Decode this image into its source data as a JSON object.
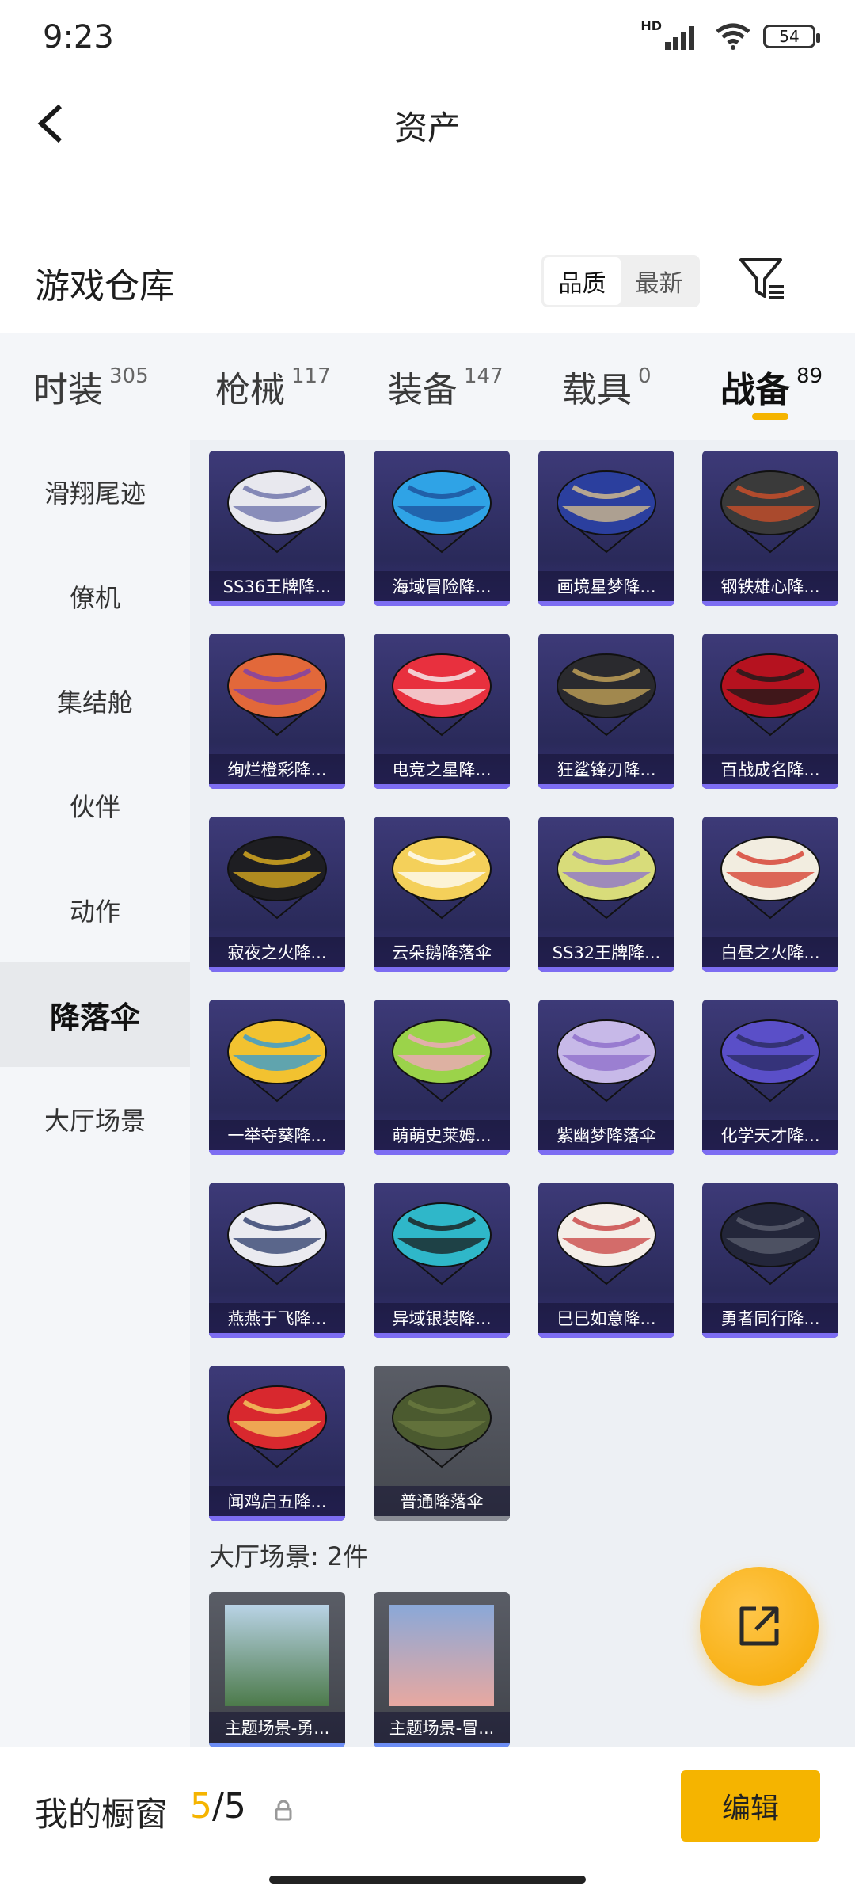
{
  "status_bar": {
    "time": "9:23",
    "hd": "HD",
    "battery": "54"
  },
  "header": {
    "title": "资产"
  },
  "warehouse": {
    "title": "游戏仓库",
    "sort_options": [
      "品质",
      "最新"
    ],
    "sort_active": "品质"
  },
  "tabs": [
    {
      "label": "时装",
      "count": "305"
    },
    {
      "label": "枪械",
      "count": "117"
    },
    {
      "label": "装备",
      "count": "147"
    },
    {
      "label": "载具",
      "count": "0"
    },
    {
      "label": "战备",
      "count": "89",
      "active": true
    }
  ],
  "side_nav": [
    "滑翔尾迹",
    "僚机",
    "集结舱",
    "伙伴",
    "动作",
    "降落伞",
    "大厅场景"
  ],
  "side_nav_active": "降落伞",
  "parachutes": [
    {
      "name": "SS36王牌降...",
      "colors": [
        "#e8e8ee",
        "#6a6fa8"
      ]
    },
    {
      "name": "海域冒险降...",
      "colors": [
        "#2fa3e6",
        "#1d4f9a"
      ]
    },
    {
      "name": "画境星梦降...",
      "colors": [
        "#2b3f9e",
        "#d9c18c"
      ]
    },
    {
      "name": "钢铁雄心降...",
      "colors": [
        "#3a3a3a",
        "#d0502a"
      ]
    },
    {
      "name": "绚烂橙彩降...",
      "colors": [
        "#e2683a",
        "#7a3fae"
      ]
    },
    {
      "name": "电竞之星降...",
      "colors": [
        "#e8303e",
        "#f5f5f5"
      ]
    },
    {
      "name": "狂鲨锋刃降...",
      "colors": [
        "#2a2a2e",
        "#c9a85a"
      ]
    },
    {
      "name": "百战成名降...",
      "colors": [
        "#b5121f",
        "#1a1a1a"
      ]
    },
    {
      "name": "寂夜之火降...",
      "colors": [
        "#1e1e22",
        "#e0b020"
      ]
    },
    {
      "name": "云朵鹅降落伞",
      "colors": [
        "#f4d05a",
        "#ffffff"
      ]
    },
    {
      "name": "SS32王牌降...",
      "colors": [
        "#d8dc7a",
        "#8b6fd0"
      ]
    },
    {
      "name": "白昼之火降...",
      "colors": [
        "#f2ede0",
        "#d4382a"
      ]
    },
    {
      "name": "一举夺葵降...",
      "colors": [
        "#f2c230",
        "#2f9ad8"
      ]
    },
    {
      "name": "萌萌史莱姆...",
      "colors": [
        "#9bd34a",
        "#f3a6c0"
      ]
    },
    {
      "name": "紫幽梦降落伞",
      "colors": [
        "#c7b9e8",
        "#8c6cc9"
      ]
    },
    {
      "name": "化学天才降...",
      "colors": [
        "#5a4fc8",
        "#2a2a60"
      ]
    },
    {
      "name": "燕燕于飞降...",
      "colors": [
        "#eaeaf0",
        "#2a3a6a"
      ]
    },
    {
      "name": "异域银装降...",
      "colors": [
        "#2fb7c9",
        "#1a1a1a"
      ]
    },
    {
      "name": "巳巳如意降...",
      "colors": [
        "#f4eee8",
        "#c84040"
      ]
    },
    {
      "name": "勇者同行降...",
      "colors": [
        "#23263a",
        "#5c6070"
      ]
    },
    {
      "name": "闻鸡启五降...",
      "colors": [
        "#d8282e",
        "#f5d060"
      ]
    },
    {
      "name": "普通降落伞",
      "colors": [
        "#4b5a2f",
        "#6a7a40"
      ],
      "gray": true
    }
  ],
  "scene_section": {
    "title": "大厅场景: 2件",
    "items": [
      {
        "name": "主题场景-勇...",
        "colors": [
          "#b9d3e6",
          "#4c7a4a"
        ]
      },
      {
        "name": "主题场景-冒...",
        "colors": [
          "#8aa8d8",
          "#e8a8a0"
        ]
      }
    ]
  },
  "bottom": {
    "showcase_label": "我的橱窗",
    "count_current": "5",
    "count_sep": "/",
    "count_total": "5",
    "edit_label": "编辑"
  }
}
